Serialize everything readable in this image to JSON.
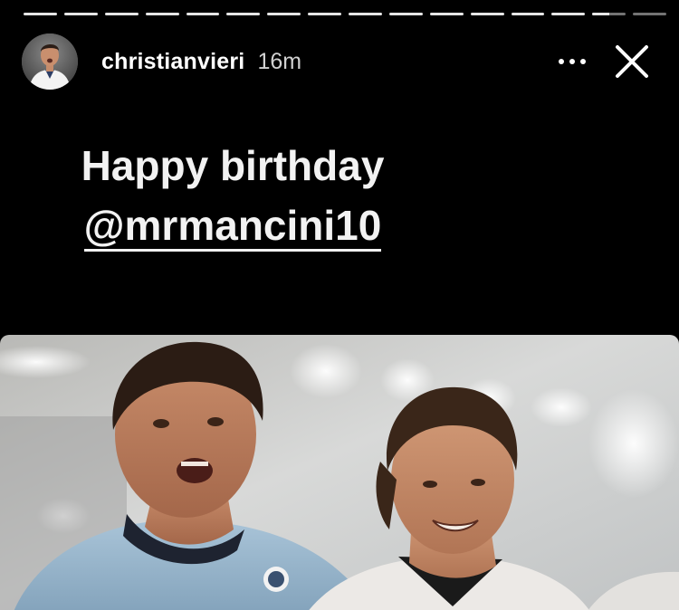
{
  "story": {
    "segments_total": 16,
    "segments_done": 14,
    "current_segment_progress": 0.5
  },
  "header": {
    "username": "christianvieri",
    "timestamp": "16m",
    "more_icon": "more-horizontal-icon",
    "close_icon": "close-icon"
  },
  "caption": {
    "line1": "Happy birthday",
    "mention": "@mrmancini10"
  },
  "photo": {
    "alt": "two-football-players-celebrating-photo"
  },
  "colors": {
    "background": "#000000",
    "text": "#f2f2f2",
    "progress_done": "#e6e6e6",
    "progress_pending": "rgba(255,255,255,0.45)",
    "jersey": "#8fb2cc"
  }
}
